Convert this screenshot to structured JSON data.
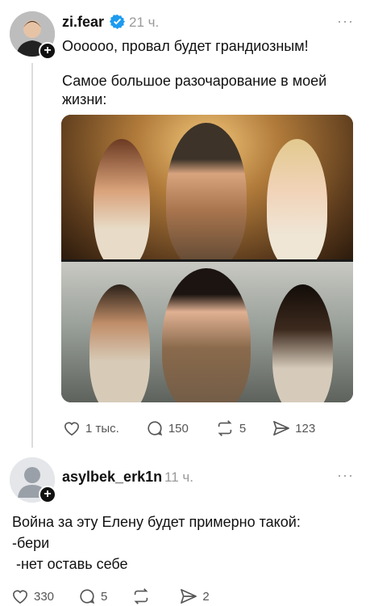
{
  "post": {
    "username": "zi.fear",
    "time": "21 ч.",
    "more": "···",
    "line1": "Oooooo, провал будет грандиозным!",
    "line2": "Самое большое разочарование в моей",
    "line3": "жизни:",
    "likes": "1 тыс.",
    "comments": "150",
    "reposts": "5",
    "shares": "123"
  },
  "reply": {
    "username": "asylbek_erk1n",
    "time": "11 ч.",
    "more": "···",
    "line1": "Война за эту Елену будет примерно такой:",
    "line2": "-бери",
    "line3": " -нет оставь себе",
    "likes": "330",
    "comments": "5",
    "reposts": "",
    "shares": "2"
  },
  "colors": {
    "verified": "#1d9bf0",
    "muted": "#9a9a9a",
    "text": "#111111"
  },
  "icons": [
    "heart-icon",
    "comment-icon",
    "repost-icon",
    "share-icon",
    "verified-icon",
    "plus-icon",
    "more-icon"
  ]
}
